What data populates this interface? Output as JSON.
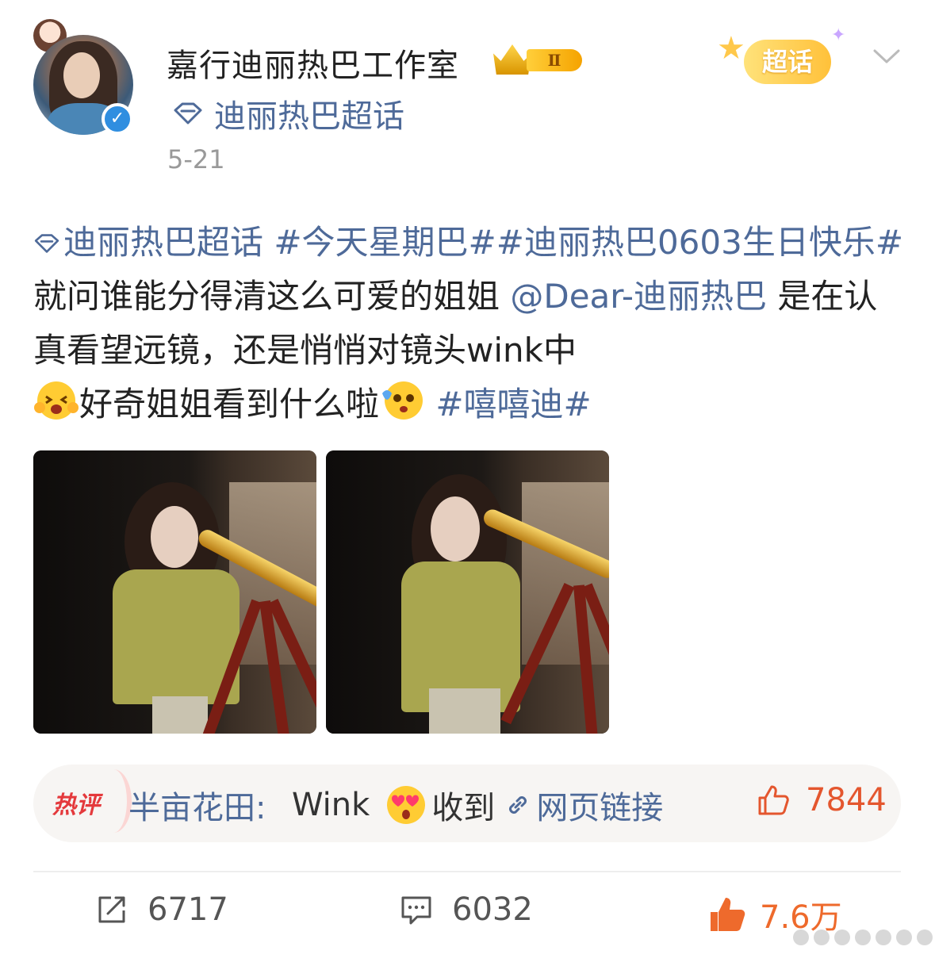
{
  "header": {
    "username": "嘉行迪丽热巴工作室",
    "vip_level": "Ⅱ",
    "supertopic": "迪丽热巴超话",
    "date": "5-21",
    "chaohua_badge": "超话"
  },
  "post": {
    "segments": [
      {
        "text": "迪丽热巴超话",
        "type": "link"
      },
      {
        "text": " #今天星期巴##迪丽热巴0603生日快乐# ",
        "type": "link"
      },
      {
        "text": "就问谁能分得清这么可爱的姐姐 ",
        "type": "text"
      },
      {
        "text": "@Dear-迪丽热巴",
        "type": "link"
      },
      {
        "text": " 是在认真看望远镜，还是悄悄对镜头wink中",
        "type": "text"
      },
      {
        "text": "好奇姐姐看到什么啦",
        "type": "text"
      },
      {
        "text": " #嘻嘻迪#",
        "type": "link"
      }
    ]
  },
  "hot_comment": {
    "label": "热评",
    "author": "半亩花田: ",
    "text": "Wink",
    "text_after": "收到",
    "link_label": "网页链接",
    "likes": "7844"
  },
  "actions": {
    "reposts": "6717",
    "comments": "6032",
    "likes": "7.6万"
  },
  "colors": {
    "link": "#4e6a99",
    "hot_red": "#e4393c",
    "like_orange": "#ee6a2c"
  }
}
